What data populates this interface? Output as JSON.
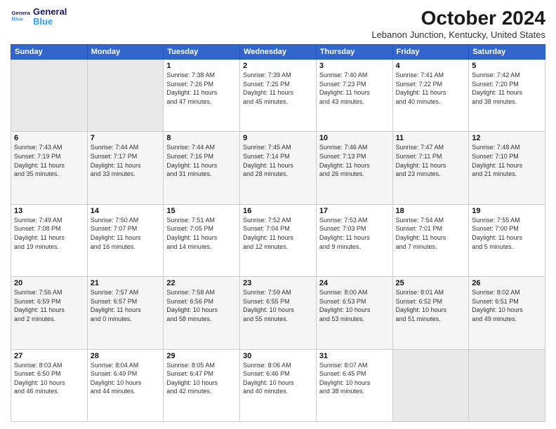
{
  "header": {
    "logo_line1": "General",
    "logo_line2": "Blue",
    "month_title": "October 2024",
    "location": "Lebanon Junction, Kentucky, United States"
  },
  "weekdays": [
    "Sunday",
    "Monday",
    "Tuesday",
    "Wednesday",
    "Thursday",
    "Friday",
    "Saturday"
  ],
  "weeks": [
    [
      {
        "day": "",
        "info": ""
      },
      {
        "day": "",
        "info": ""
      },
      {
        "day": "1",
        "info": "Sunrise: 7:38 AM\nSunset: 7:26 PM\nDaylight: 11 hours\nand 47 minutes."
      },
      {
        "day": "2",
        "info": "Sunrise: 7:39 AM\nSunset: 7:25 PM\nDaylight: 11 hours\nand 45 minutes."
      },
      {
        "day": "3",
        "info": "Sunrise: 7:40 AM\nSunset: 7:23 PM\nDaylight: 11 hours\nand 43 minutes."
      },
      {
        "day": "4",
        "info": "Sunrise: 7:41 AM\nSunset: 7:22 PM\nDaylight: 11 hours\nand 40 minutes."
      },
      {
        "day": "5",
        "info": "Sunrise: 7:42 AM\nSunset: 7:20 PM\nDaylight: 11 hours\nand 38 minutes."
      }
    ],
    [
      {
        "day": "6",
        "info": "Sunrise: 7:43 AM\nSunset: 7:19 PM\nDaylight: 11 hours\nand 35 minutes."
      },
      {
        "day": "7",
        "info": "Sunrise: 7:44 AM\nSunset: 7:17 PM\nDaylight: 11 hours\nand 33 minutes."
      },
      {
        "day": "8",
        "info": "Sunrise: 7:44 AM\nSunset: 7:16 PM\nDaylight: 11 hours\nand 31 minutes."
      },
      {
        "day": "9",
        "info": "Sunrise: 7:45 AM\nSunset: 7:14 PM\nDaylight: 11 hours\nand 28 minutes."
      },
      {
        "day": "10",
        "info": "Sunrise: 7:46 AM\nSunset: 7:13 PM\nDaylight: 11 hours\nand 26 minutes."
      },
      {
        "day": "11",
        "info": "Sunrise: 7:47 AM\nSunset: 7:11 PM\nDaylight: 11 hours\nand 23 minutes."
      },
      {
        "day": "12",
        "info": "Sunrise: 7:48 AM\nSunset: 7:10 PM\nDaylight: 11 hours\nand 21 minutes."
      }
    ],
    [
      {
        "day": "13",
        "info": "Sunrise: 7:49 AM\nSunset: 7:08 PM\nDaylight: 11 hours\nand 19 minutes."
      },
      {
        "day": "14",
        "info": "Sunrise: 7:50 AM\nSunset: 7:07 PM\nDaylight: 11 hours\nand 16 minutes."
      },
      {
        "day": "15",
        "info": "Sunrise: 7:51 AM\nSunset: 7:05 PM\nDaylight: 11 hours\nand 14 minutes."
      },
      {
        "day": "16",
        "info": "Sunrise: 7:52 AM\nSunset: 7:04 PM\nDaylight: 11 hours\nand 12 minutes."
      },
      {
        "day": "17",
        "info": "Sunrise: 7:53 AM\nSunset: 7:03 PM\nDaylight: 11 hours\nand 9 minutes."
      },
      {
        "day": "18",
        "info": "Sunrise: 7:54 AM\nSunset: 7:01 PM\nDaylight: 11 hours\nand 7 minutes."
      },
      {
        "day": "19",
        "info": "Sunrise: 7:55 AM\nSunset: 7:00 PM\nDaylight: 11 hours\nand 5 minutes."
      }
    ],
    [
      {
        "day": "20",
        "info": "Sunrise: 7:56 AM\nSunset: 6:59 PM\nDaylight: 11 hours\nand 2 minutes."
      },
      {
        "day": "21",
        "info": "Sunrise: 7:57 AM\nSunset: 6:57 PM\nDaylight: 11 hours\nand 0 minutes."
      },
      {
        "day": "22",
        "info": "Sunrise: 7:58 AM\nSunset: 6:56 PM\nDaylight: 10 hours\nand 58 minutes."
      },
      {
        "day": "23",
        "info": "Sunrise: 7:59 AM\nSunset: 6:55 PM\nDaylight: 10 hours\nand 55 minutes."
      },
      {
        "day": "24",
        "info": "Sunrise: 8:00 AM\nSunset: 6:53 PM\nDaylight: 10 hours\nand 53 minutes."
      },
      {
        "day": "25",
        "info": "Sunrise: 8:01 AM\nSunset: 6:52 PM\nDaylight: 10 hours\nand 51 minutes."
      },
      {
        "day": "26",
        "info": "Sunrise: 8:02 AM\nSunset: 6:51 PM\nDaylight: 10 hours\nand 49 minutes."
      }
    ],
    [
      {
        "day": "27",
        "info": "Sunrise: 8:03 AM\nSunset: 6:50 PM\nDaylight: 10 hours\nand 46 minutes."
      },
      {
        "day": "28",
        "info": "Sunrise: 8:04 AM\nSunset: 6:49 PM\nDaylight: 10 hours\nand 44 minutes."
      },
      {
        "day": "29",
        "info": "Sunrise: 8:05 AM\nSunset: 6:47 PM\nDaylight: 10 hours\nand 42 minutes."
      },
      {
        "day": "30",
        "info": "Sunrise: 8:06 AM\nSunset: 6:46 PM\nDaylight: 10 hours\nand 40 minutes."
      },
      {
        "day": "31",
        "info": "Sunrise: 8:07 AM\nSunset: 6:45 PM\nDaylight: 10 hours\nand 38 minutes."
      },
      {
        "day": "",
        "info": ""
      },
      {
        "day": "",
        "info": ""
      }
    ]
  ]
}
